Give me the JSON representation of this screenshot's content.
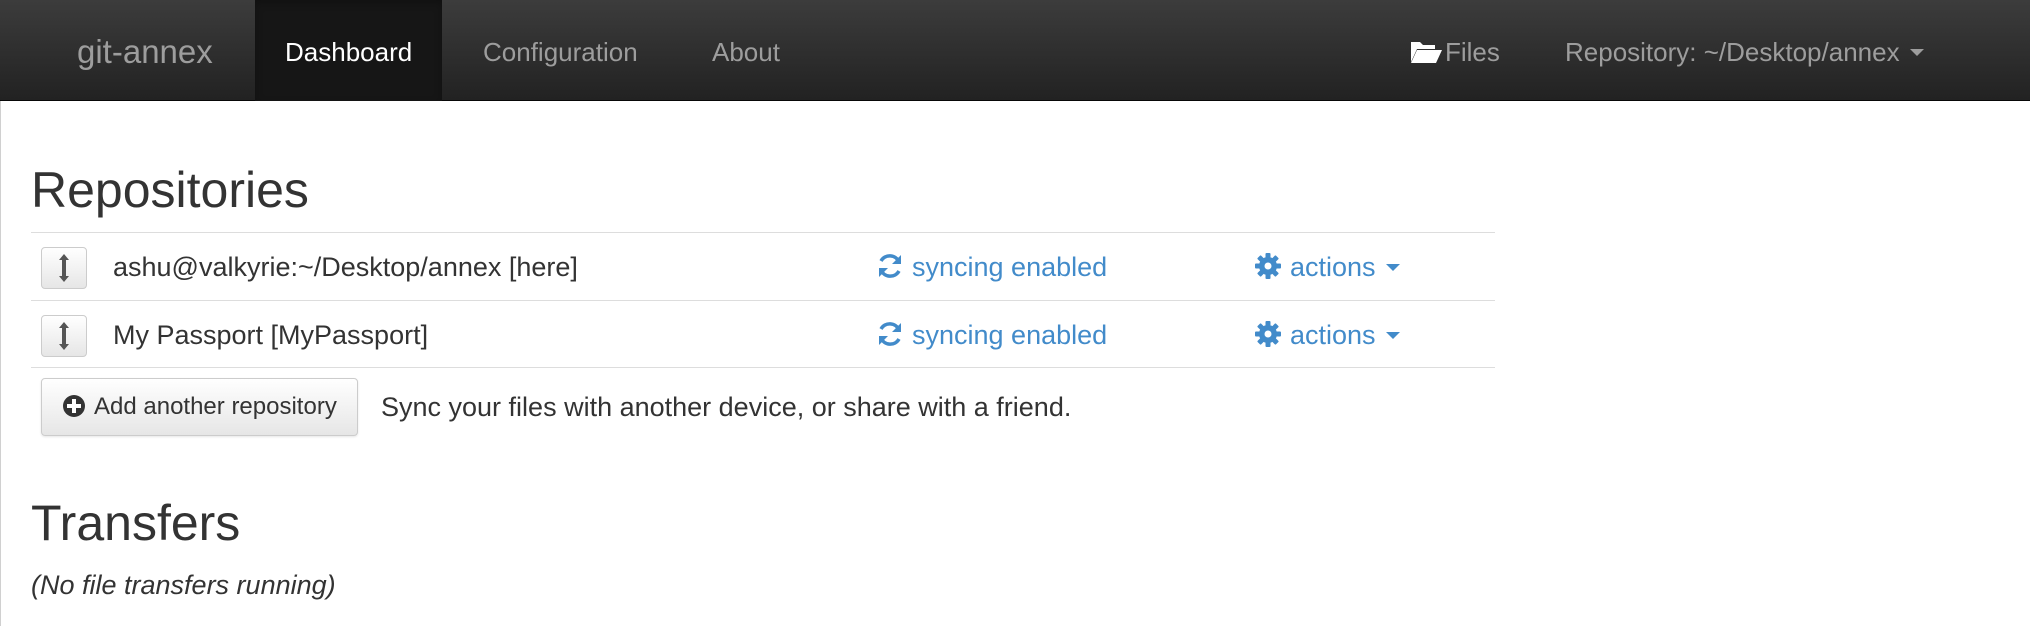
{
  "navbar": {
    "brand": "git-annex",
    "items": [
      {
        "label": "Dashboard",
        "active": true
      },
      {
        "label": "Configuration",
        "active": false
      },
      {
        "label": "About",
        "active": false
      }
    ],
    "files_label": "Files",
    "files_icon": "folder-open-icon",
    "repository_label": "Repository: ~/Desktop/annex"
  },
  "repositories": {
    "heading": "Repositories",
    "rows": [
      {
        "name": "ashu@valkyrie:~/Desktop/annex [here]",
        "sync_label": "syncing enabled",
        "actions_label": "actions"
      },
      {
        "name": "My Passport [MyPassport]",
        "sync_label": "syncing enabled",
        "actions_label": "actions"
      }
    ],
    "add_button_label": "Add another repository",
    "add_hint": "Sync your files with another device, or share with a friend."
  },
  "transfers": {
    "heading": "Transfers",
    "empty_message": "(No file transfers running)"
  },
  "colors": {
    "navbar_bg": "#222222",
    "navbar_text": "#9d9d9d",
    "navbar_active_text": "#ffffff",
    "link": "#428bca",
    "text": "#333333"
  }
}
